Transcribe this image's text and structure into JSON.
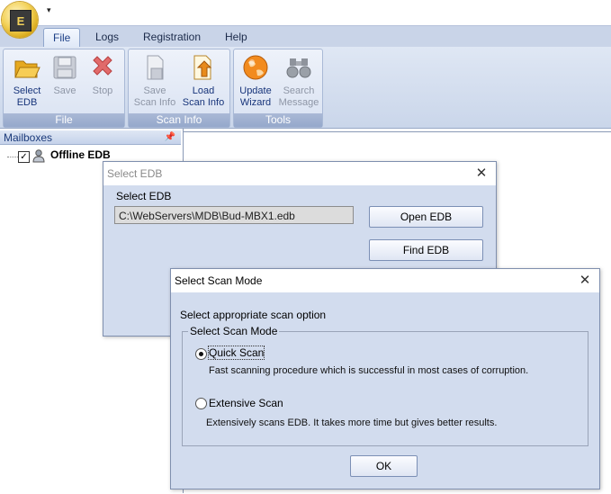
{
  "ribbon": {
    "tabs": [
      "File",
      "Logs",
      "Registration",
      "Help"
    ],
    "groups": {
      "file": {
        "label": "File",
        "select_edb": "Select\nEDB",
        "save": "Save",
        "stop": "Stop"
      },
      "scan_info": {
        "label": "Scan Info",
        "save_scan_info": "Save\nScan Info",
        "load_scan_info": "Load\nScan Info"
      },
      "tools": {
        "label": "Tools",
        "update_wizard": "Update\nWizard",
        "search_message": "Search\nMessage"
      }
    }
  },
  "left_pane": {
    "header": "Mailboxes",
    "tree_item": "Offline EDB"
  },
  "select_edb_dialog": {
    "title": "Select EDB",
    "label": "Select EDB",
    "path_value": "C:\\WebServers\\MDB\\Bud-MBX1.edb",
    "open_button": "Open EDB",
    "find_button": "Find EDB"
  },
  "scan_mode_dialog": {
    "title": "Select Scan Mode",
    "prompt": "Select appropriate scan option",
    "group_label": "Select Scan Mode",
    "quick_label": "Quick Scan",
    "quick_desc": "Fast scanning procedure which is successful in most cases of corruption.",
    "extensive_label": "Extensive Scan",
    "extensive_desc": "Extensively scans EDB. It takes more time but gives better results.",
    "ok_button": "OK",
    "selected": "quick"
  },
  "icons": {
    "app": "app-orb-icon",
    "quick_access": "dropdown-arrow-icon",
    "select_edb": "open-folder-icon",
    "save": "floppy-disk-icon",
    "stop": "red-x-icon",
    "save_scan_info": "save-document-icon",
    "load_scan_info": "load-document-icon",
    "update_wizard": "globe-icon",
    "search_message": "binoculars-icon",
    "pin": "pin-icon",
    "tree": "mailbox-user-icon",
    "close": "close-icon"
  }
}
